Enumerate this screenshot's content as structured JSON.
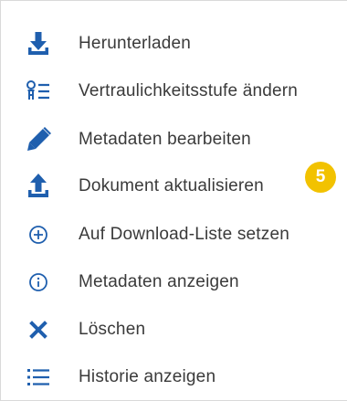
{
  "menu": {
    "items": [
      {
        "label": "Herunterladen",
        "icon": "download-icon"
      },
      {
        "label": "Vertraulichkeitsstufe ändern",
        "icon": "confidentiality-level-icon"
      },
      {
        "label": "Metadaten bearbeiten",
        "icon": "pencil-icon"
      },
      {
        "label": "Dokument aktualisieren",
        "icon": "upload-icon"
      },
      {
        "label": "Auf Download-Liste setzen",
        "icon": "plus-circle-icon"
      },
      {
        "label": "Metadaten anzeigen",
        "icon": "info-circle-icon"
      },
      {
        "label": "Löschen",
        "icon": "close-x-icon"
      },
      {
        "label": "Historie anzeigen",
        "icon": "list-icon"
      }
    ]
  },
  "badge": {
    "text": "5",
    "color": "#f2c200"
  },
  "colors": {
    "icon": "#1f5fae",
    "text": "#3a3a3a",
    "background": "#ffffff"
  }
}
